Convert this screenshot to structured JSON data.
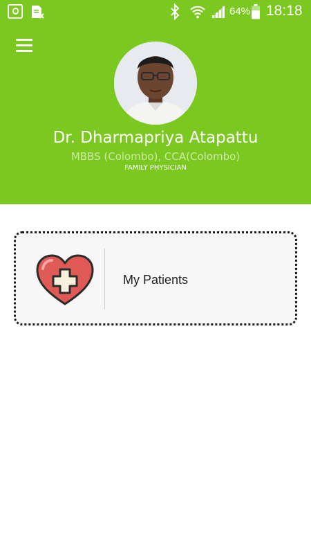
{
  "status_bar": {
    "battery": "64%",
    "time": "18:18"
  },
  "header": {
    "menu_icon": "hamburger-icon",
    "doctor_name": "Dr. Dharmapriya Atapattu",
    "qualifications": "MBBS (Colombo), CCA(Colombo)",
    "role": "FAMILY PHYSICIAN"
  },
  "menu_items": [
    {
      "label": "My Patients",
      "icon": "heart-plus-icon"
    }
  ],
  "colors": {
    "primary": "#7bc820",
    "card_background": "#f7f7f7",
    "heart": "#e05a55"
  }
}
